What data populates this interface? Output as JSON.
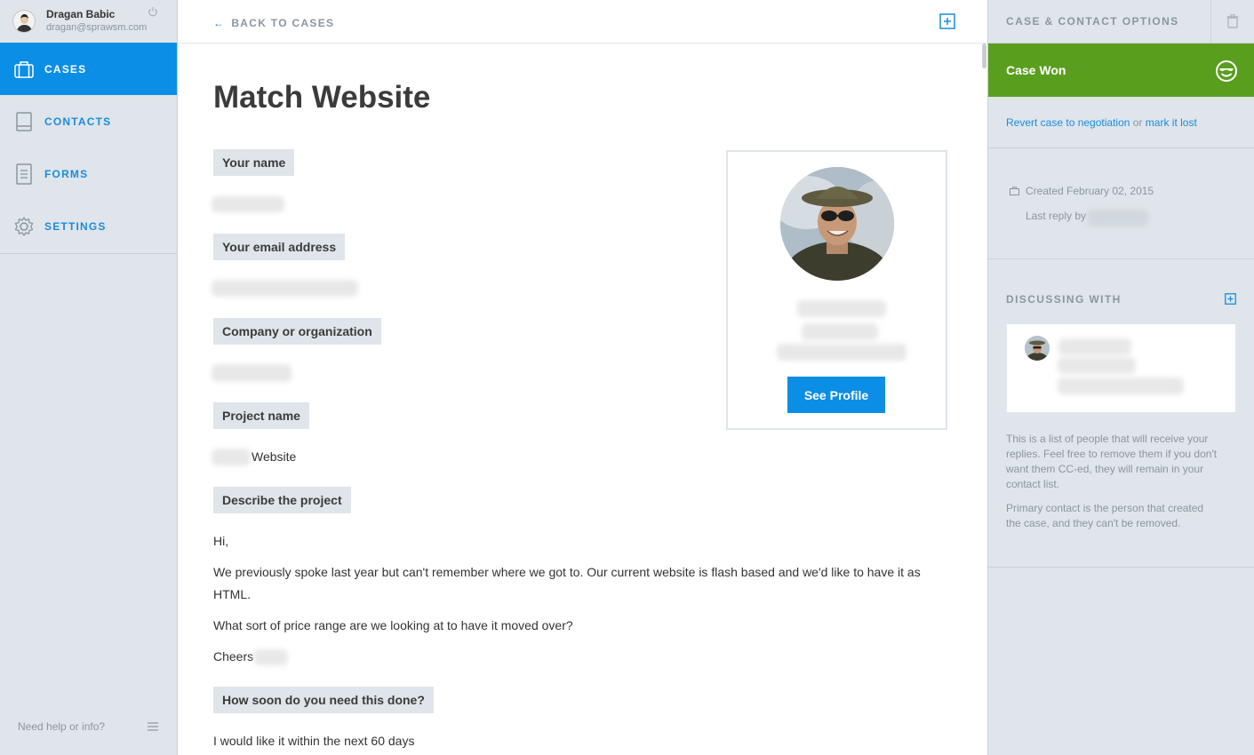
{
  "user": {
    "name": "Dragan Babic",
    "email": "dragan@sprawsm.com"
  },
  "nav": [
    {
      "label": "CASES",
      "icon": "briefcase-icon",
      "active": true
    },
    {
      "label": "CONTACTS",
      "icon": "book-icon",
      "active": false
    },
    {
      "label": "FORMS",
      "icon": "form-icon",
      "active": false
    },
    {
      "label": "SETTINGS",
      "icon": "gear-icon",
      "active": false
    }
  ],
  "help_text": "Need help or info?",
  "main": {
    "back_label": "BACK TO CASES",
    "title": "Match Website",
    "fields": [
      {
        "label": "Your name"
      },
      {
        "label": "Your email address"
      },
      {
        "label": "Company or organization"
      },
      {
        "label": "Project name",
        "value": "Website"
      },
      {
        "label": "Describe the project"
      },
      {
        "label": "How soon do you need this done?",
        "value": "I would like it within the next 60 days"
      }
    ],
    "description": [
      "Hi,",
      "We previously spoke last year but can't remember where we got to. Our current website is flash based and we'd like to have it as HTML.",
      "What sort of price range are we looking at to have it moved over?",
      "Cheers"
    ],
    "profile_button": "See Profile"
  },
  "right_panel": {
    "title": "CASE & CONTACT OPTIONS",
    "status": "Case Won",
    "revert_link": "Revert case to negotiation",
    "revert_or": "or",
    "lost_link": "mark it lost",
    "created": "Created February 02, 2015",
    "last_reply": "Last reply by",
    "discussing_title": "DISCUSSING WITH",
    "info_1": "This is a list of people that will receive your replies. Feel free to remove them if you don't want them CC-ed, they will remain in your contact list.",
    "info_2": "Primary contact is the person that created the case, and they can't be removed."
  },
  "colors": {
    "accent": "#0b8ee6",
    "success": "#5a9e1e",
    "panel": "#dfe5ea",
    "muted": "#8b96a0"
  }
}
